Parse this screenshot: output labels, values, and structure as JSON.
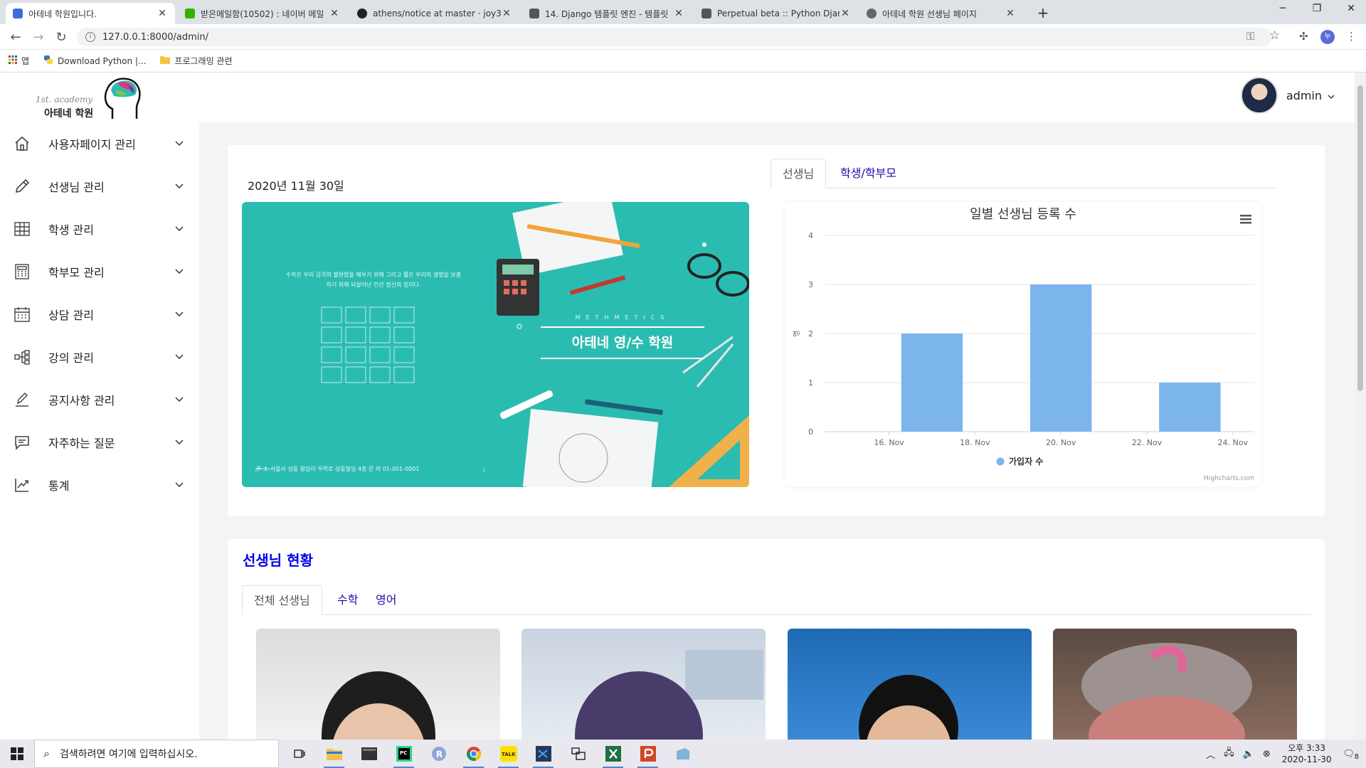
{
  "browser": {
    "tabs": [
      {
        "title": "아테네 학원입니다.",
        "favicon_color": "#3b6fd8",
        "active": true
      },
      {
        "title": "받은메일함(10502) : 네이버 메일",
        "favicon_color": "#2db400",
        "active": false
      },
      {
        "title": "athens/notice at master · joy39",
        "favicon_color": "#222222",
        "active": false
      },
      {
        "title": "14. Django 템플릿 엔진 - 템플릿",
        "favicon_color": "#555555",
        "active": false
      },
      {
        "title": "Perpetual beta :: Python Django",
        "favicon_color": "#555555",
        "active": false
      },
      {
        "title": "아테네 학원 선생님 페이지",
        "favicon_color": "#666666",
        "active": false
      }
    ],
    "new_tab_symbol": "+",
    "url": "127.0.0.1:8000/admin/",
    "profile_initial": "누",
    "bookmarks": [
      {
        "label": "앱",
        "icon": "apps-grid-icon"
      },
      {
        "label": "Download Python |...",
        "icon": "python-icon"
      },
      {
        "label": "프로그래밍 관련",
        "icon": "folder-icon"
      }
    ]
  },
  "sidebar": {
    "logo_line1": "1st. academy",
    "logo_line2": "아테네 학원",
    "items": [
      {
        "label": "사용자페이지 관리",
        "icon": "home-icon"
      },
      {
        "label": "선생님 관리",
        "icon": "pencil-icon"
      },
      {
        "label": "학생 관리",
        "icon": "table-grid-icon"
      },
      {
        "label": "학부모 관리",
        "icon": "calculator-icon"
      },
      {
        "label": "상담 관리",
        "icon": "calendar-icon"
      },
      {
        "label": "강의 관리",
        "icon": "sitemap-icon"
      },
      {
        "label": "공지사항 관리",
        "icon": "edit-icon"
      },
      {
        "label": "자주하는 질문",
        "icon": "chat-icon"
      },
      {
        "label": "통계",
        "icon": "chart-line-icon"
      }
    ]
  },
  "header": {
    "username": "admin"
  },
  "dashboard": {
    "date": "2020년 11월 30일",
    "banner": {
      "super": "METHMETICS",
      "title": "아테네 영/수 학원",
      "quote": "수학은 우리 감각의 불완함을 메우기 위해 그리고 짧은 우리의 생명을 보충하기 위해 되살아난 인간 정신의 힘이다.",
      "footer": "주 소   서울시 성동 왕십리 우학로 성동빌딩 4층      문 의   01-001-0001"
    },
    "chart_tabs": [
      "선생님",
      "학생/학부모"
    ],
    "section_title": "선생님 현황",
    "teacher_tabs": [
      "전체 선생님",
      "수학",
      "영어"
    ]
  },
  "chart_data": {
    "type": "bar",
    "title": "일별 선생님 등록 수",
    "ylabel": "명",
    "x_start": "2020-11-15",
    "x_ticks": [
      "16. Nov",
      "18. Nov",
      "20. Nov",
      "22. Nov",
      "24. Nov"
    ],
    "y_ticks": [
      0,
      1,
      2,
      3,
      4
    ],
    "ylim": [
      0,
      4
    ],
    "series": [
      {
        "name": "가입자 수",
        "color": "#7cb5ec",
        "points": [
          {
            "date": "17. Nov",
            "value": 2
          },
          {
            "date": "20. Nov",
            "value": 3
          },
          {
            "date": "23. Nov",
            "value": 1
          }
        ]
      }
    ],
    "legend_position": "bottom-center",
    "credits": "Highcharts.com",
    "grid": true
  },
  "taskbar": {
    "search_placeholder": "검색하려면 여기에 입력하십시오.",
    "apps": [
      "task-view-icon",
      "file-explorer-icon",
      "terminal-icon",
      "pycharm-icon",
      "r-icon",
      "chrome-icon",
      "kakaotalk-icon",
      "vscode-icon",
      "window-manager-icon",
      "excel-icon",
      "powerpoint-icon",
      "app-icon"
    ],
    "kakao_label": "TALK",
    "clock_time": "오후 3:33",
    "clock_date": "2020-11-30",
    "notification_count": "8"
  }
}
